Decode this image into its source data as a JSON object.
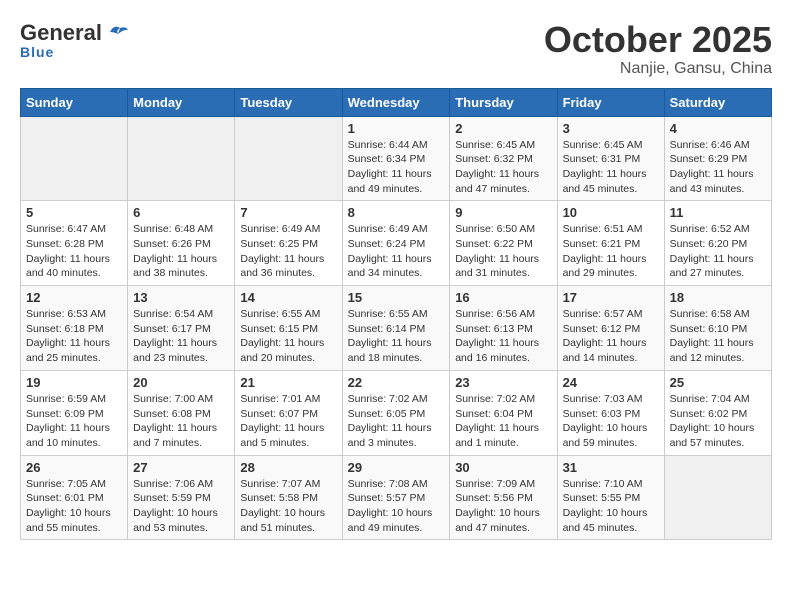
{
  "header": {
    "logo_general": "General",
    "logo_blue": "Blue",
    "title": "October 2025",
    "subtitle": "Nanjie, Gansu, China"
  },
  "weekdays": [
    "Sunday",
    "Monday",
    "Tuesday",
    "Wednesday",
    "Thursday",
    "Friday",
    "Saturday"
  ],
  "weeks": [
    [
      {
        "day": "",
        "info": ""
      },
      {
        "day": "",
        "info": ""
      },
      {
        "day": "",
        "info": ""
      },
      {
        "day": "1",
        "info": "Sunrise: 6:44 AM\nSunset: 6:34 PM\nDaylight: 11 hours and 49 minutes."
      },
      {
        "day": "2",
        "info": "Sunrise: 6:45 AM\nSunset: 6:32 PM\nDaylight: 11 hours and 47 minutes."
      },
      {
        "day": "3",
        "info": "Sunrise: 6:45 AM\nSunset: 6:31 PM\nDaylight: 11 hours and 45 minutes."
      },
      {
        "day": "4",
        "info": "Sunrise: 6:46 AM\nSunset: 6:29 PM\nDaylight: 11 hours and 43 minutes."
      }
    ],
    [
      {
        "day": "5",
        "info": "Sunrise: 6:47 AM\nSunset: 6:28 PM\nDaylight: 11 hours and 40 minutes."
      },
      {
        "day": "6",
        "info": "Sunrise: 6:48 AM\nSunset: 6:26 PM\nDaylight: 11 hours and 38 minutes."
      },
      {
        "day": "7",
        "info": "Sunrise: 6:49 AM\nSunset: 6:25 PM\nDaylight: 11 hours and 36 minutes."
      },
      {
        "day": "8",
        "info": "Sunrise: 6:49 AM\nSunset: 6:24 PM\nDaylight: 11 hours and 34 minutes."
      },
      {
        "day": "9",
        "info": "Sunrise: 6:50 AM\nSunset: 6:22 PM\nDaylight: 11 hours and 31 minutes."
      },
      {
        "day": "10",
        "info": "Sunrise: 6:51 AM\nSunset: 6:21 PM\nDaylight: 11 hours and 29 minutes."
      },
      {
        "day": "11",
        "info": "Sunrise: 6:52 AM\nSunset: 6:20 PM\nDaylight: 11 hours and 27 minutes."
      }
    ],
    [
      {
        "day": "12",
        "info": "Sunrise: 6:53 AM\nSunset: 6:18 PM\nDaylight: 11 hours and 25 minutes."
      },
      {
        "day": "13",
        "info": "Sunrise: 6:54 AM\nSunset: 6:17 PM\nDaylight: 11 hours and 23 minutes."
      },
      {
        "day": "14",
        "info": "Sunrise: 6:55 AM\nSunset: 6:15 PM\nDaylight: 11 hours and 20 minutes."
      },
      {
        "day": "15",
        "info": "Sunrise: 6:55 AM\nSunset: 6:14 PM\nDaylight: 11 hours and 18 minutes."
      },
      {
        "day": "16",
        "info": "Sunrise: 6:56 AM\nSunset: 6:13 PM\nDaylight: 11 hours and 16 minutes."
      },
      {
        "day": "17",
        "info": "Sunrise: 6:57 AM\nSunset: 6:12 PM\nDaylight: 11 hours and 14 minutes."
      },
      {
        "day": "18",
        "info": "Sunrise: 6:58 AM\nSunset: 6:10 PM\nDaylight: 11 hours and 12 minutes."
      }
    ],
    [
      {
        "day": "19",
        "info": "Sunrise: 6:59 AM\nSunset: 6:09 PM\nDaylight: 11 hours and 10 minutes."
      },
      {
        "day": "20",
        "info": "Sunrise: 7:00 AM\nSunset: 6:08 PM\nDaylight: 11 hours and 7 minutes."
      },
      {
        "day": "21",
        "info": "Sunrise: 7:01 AM\nSunset: 6:07 PM\nDaylight: 11 hours and 5 minutes."
      },
      {
        "day": "22",
        "info": "Sunrise: 7:02 AM\nSunset: 6:05 PM\nDaylight: 11 hours and 3 minutes."
      },
      {
        "day": "23",
        "info": "Sunrise: 7:02 AM\nSunset: 6:04 PM\nDaylight: 11 hours and 1 minute."
      },
      {
        "day": "24",
        "info": "Sunrise: 7:03 AM\nSunset: 6:03 PM\nDaylight: 10 hours and 59 minutes."
      },
      {
        "day": "25",
        "info": "Sunrise: 7:04 AM\nSunset: 6:02 PM\nDaylight: 10 hours and 57 minutes."
      }
    ],
    [
      {
        "day": "26",
        "info": "Sunrise: 7:05 AM\nSunset: 6:01 PM\nDaylight: 10 hours and 55 minutes."
      },
      {
        "day": "27",
        "info": "Sunrise: 7:06 AM\nSunset: 5:59 PM\nDaylight: 10 hours and 53 minutes."
      },
      {
        "day": "28",
        "info": "Sunrise: 7:07 AM\nSunset: 5:58 PM\nDaylight: 10 hours and 51 minutes."
      },
      {
        "day": "29",
        "info": "Sunrise: 7:08 AM\nSunset: 5:57 PM\nDaylight: 10 hours and 49 minutes."
      },
      {
        "day": "30",
        "info": "Sunrise: 7:09 AM\nSunset: 5:56 PM\nDaylight: 10 hours and 47 minutes."
      },
      {
        "day": "31",
        "info": "Sunrise: 7:10 AM\nSunset: 5:55 PM\nDaylight: 10 hours and 45 minutes."
      },
      {
        "day": "",
        "info": ""
      }
    ]
  ]
}
